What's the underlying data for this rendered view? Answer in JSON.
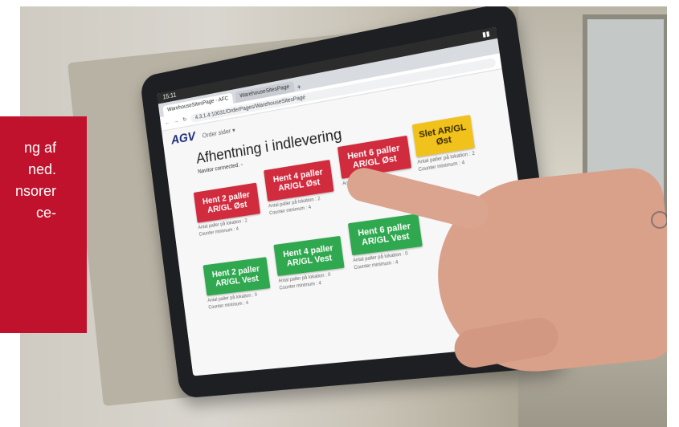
{
  "overlay_text": [
    "ng af",
    "ned.",
    "nsorer",
    "ce-"
  ],
  "tablet": {
    "status_time": "15:11",
    "tabs": [
      "WarehouseSitesPage - AFC",
      "WarehouseSitesPage"
    ],
    "url": "4.3.1.4:10031/OrderPages/WarehouseSitesPage",
    "logo": "AGV",
    "menu": "Order sider ▾",
    "title": "Afhentning i indlevering",
    "connection": "Navitor connected. ◦",
    "cards": [
      {
        "label": "Hent 2 paller AR/GL Øst",
        "color": "red",
        "info1": "Antal paller på lokation : 2",
        "info2": "Counter minimum : 4"
      },
      {
        "label": "Hent 4 paller AR/GL Øst",
        "color": "red",
        "info1": "Antal paller på lokation : 2",
        "info2": "Counter minimum : 4"
      },
      {
        "label": "Hent 6 paller AR/GL Øst",
        "color": "red",
        "info1": "Antal paller på lokation",
        "info2": ""
      },
      {
        "label": "Slet AR/GL Øst",
        "color": "yellow",
        "info1": "Antal paller på lokation : 2",
        "info2": "Counter minimum : 4"
      },
      {
        "label": "Hent 2 paller AR/GL Vest",
        "color": "green",
        "info1": "Antal paller på lokation : 0",
        "info2": "Counter minimum : 4"
      },
      {
        "label": "Hent 4 paller AR/GL Vest",
        "color": "green",
        "info1": "Antal paller på lokation : 0",
        "info2": "Counter minimum : 4"
      },
      {
        "label": "Hent 6 paller AR/GL Vest",
        "color": "green",
        "info1": "Antal paller på lokation : 0",
        "info2": "Counter minimum : 4"
      }
    ]
  }
}
